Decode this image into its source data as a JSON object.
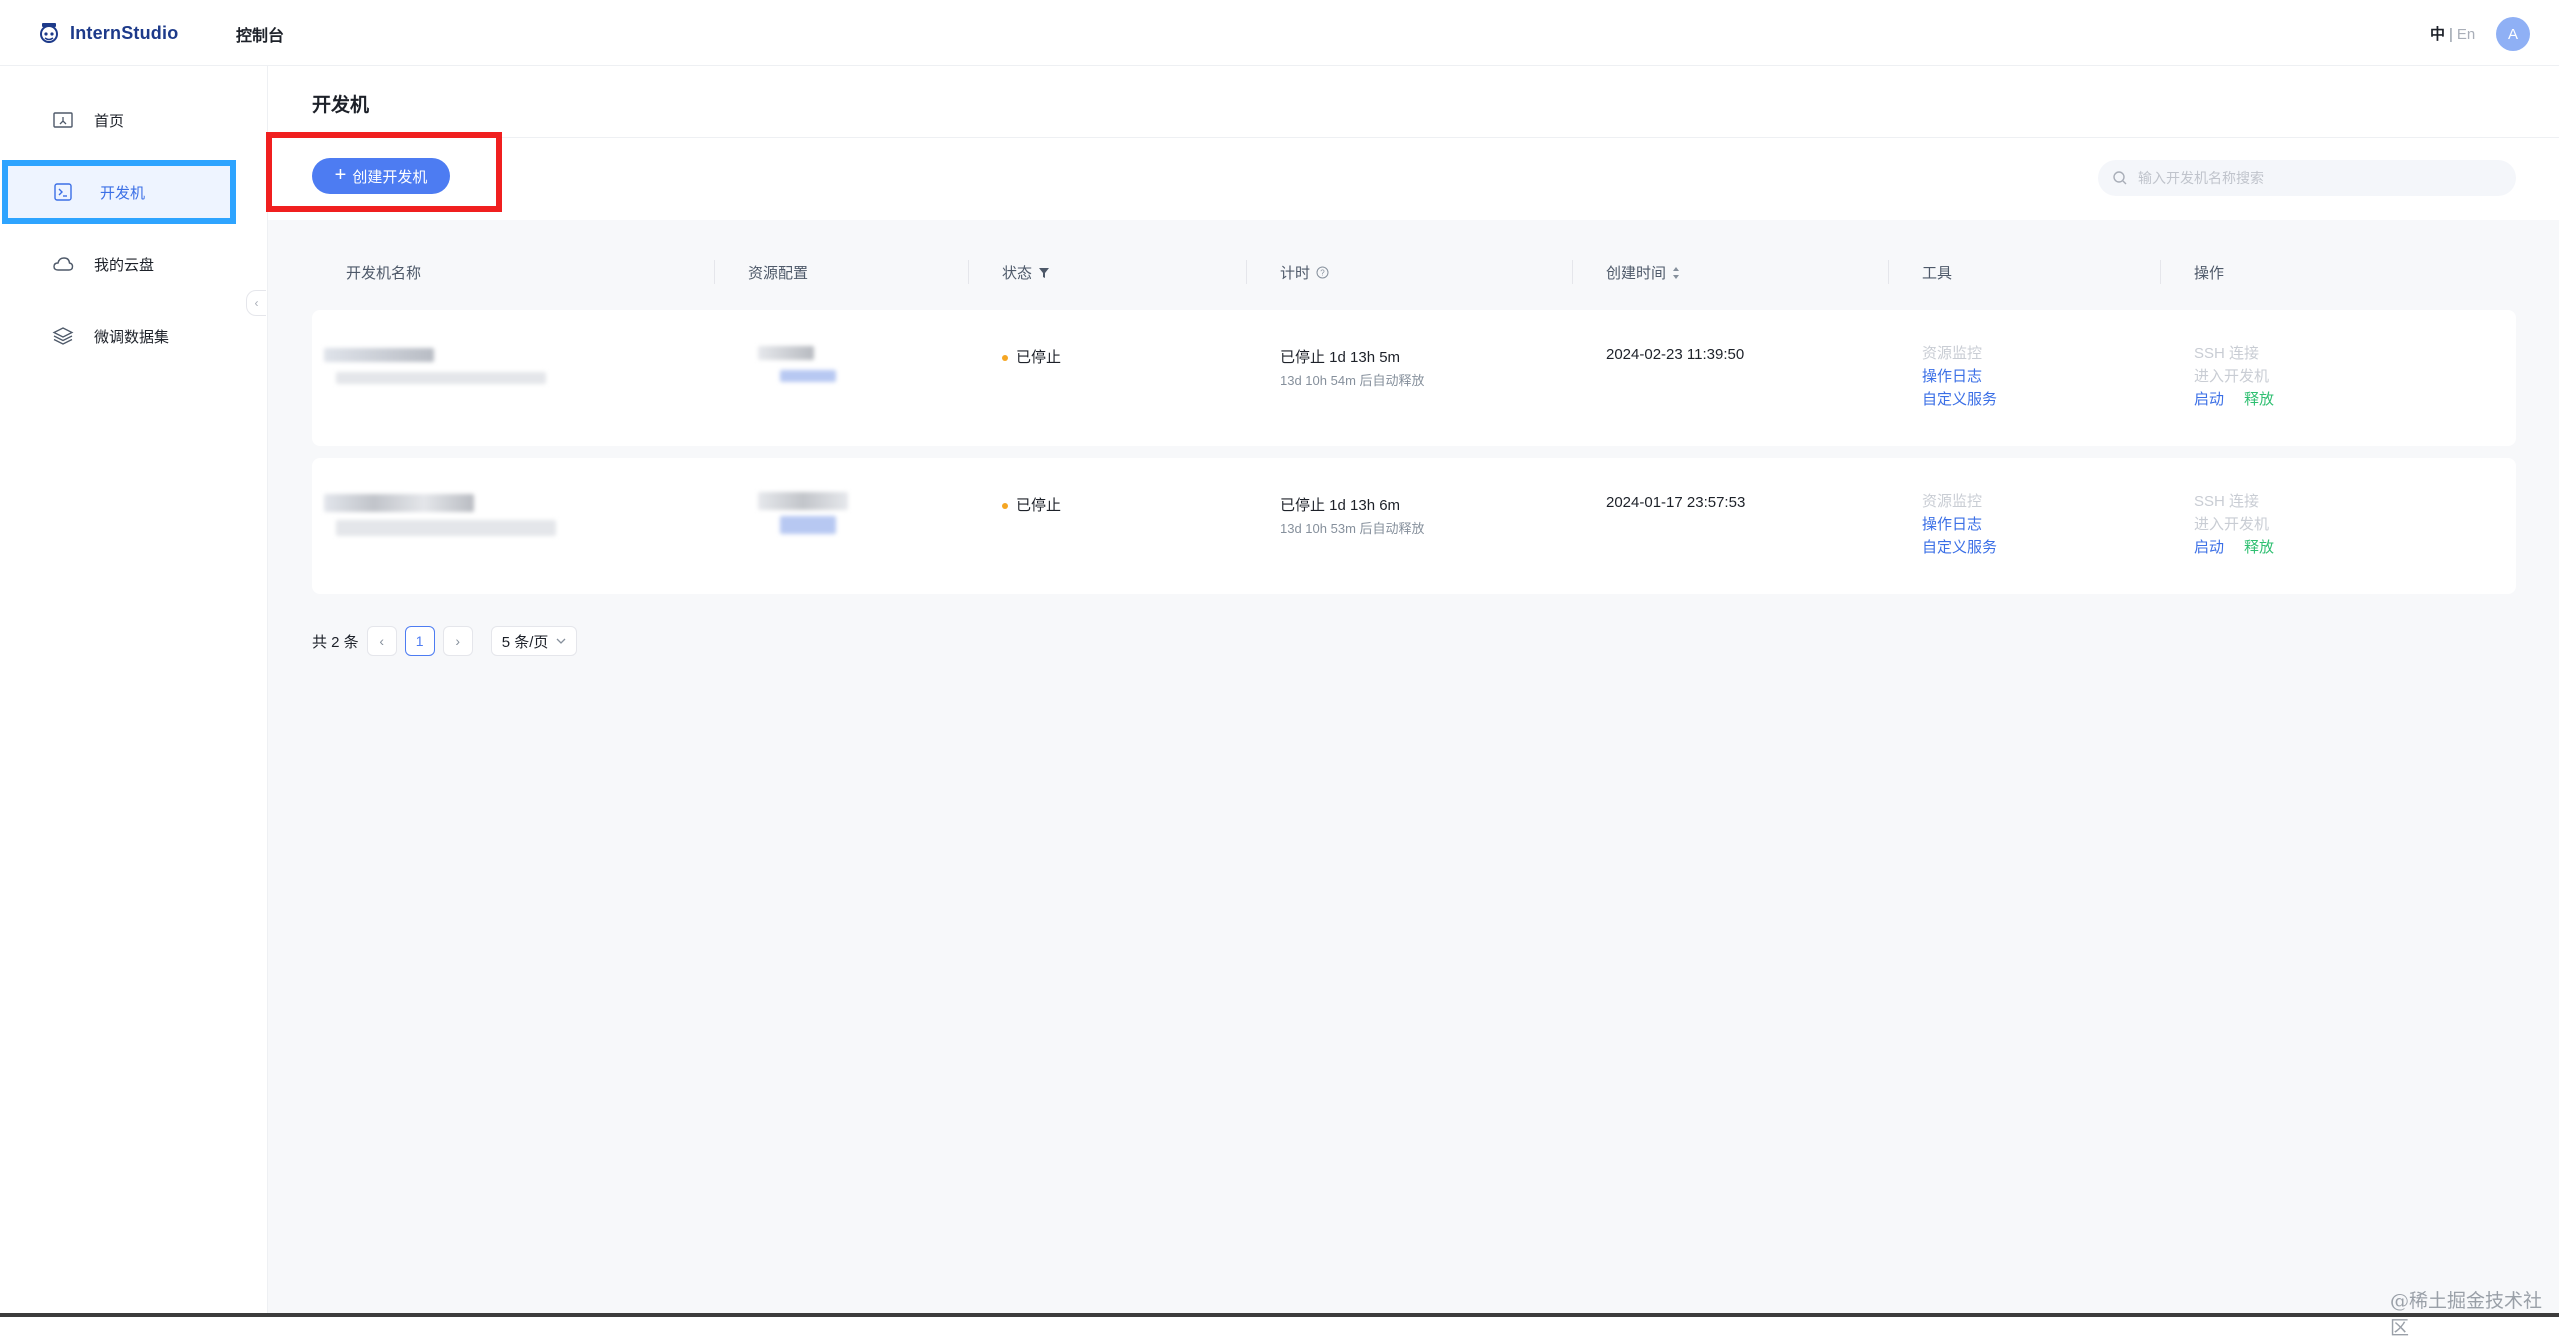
{
  "app": {
    "logo_text": "InternStudio",
    "console_label": "控制台"
  },
  "header": {
    "lang_zh": "中",
    "lang_sep": "|",
    "lang_en": "En",
    "avatar_letter": "A"
  },
  "sidebar": {
    "items": [
      {
        "label": "首页",
        "icon": "home-icon",
        "active": false
      },
      {
        "label": "开发机",
        "icon": "terminal-icon",
        "active": true
      },
      {
        "label": "我的云盘",
        "icon": "cloud-icon",
        "active": false
      },
      {
        "label": "微调数据集",
        "icon": "layers-icon",
        "active": false
      }
    ],
    "collapse_icon": "‹"
  },
  "page": {
    "title": "开发机",
    "create_button": "创建开发机",
    "search_placeholder": "输入开发机名称搜索"
  },
  "table": {
    "columns": {
      "name": "开发机名称",
      "resource": "资源配置",
      "status": "状态",
      "timer": "计时",
      "created": "创建时间",
      "tools": "工具",
      "actions": "操作"
    },
    "rows": [
      {
        "status": "已停止",
        "timer_main": "已停止  1d 13h 5m",
        "timer_sub": "13d 10h 54m 后自动释放",
        "created": "2024-02-23 11:39:50",
        "tool_monitor": "资源监控",
        "tool_log": "操作日志",
        "tool_custom": "自定义服务",
        "action_ssh": "SSH 连接",
        "action_enter": "进入开发机",
        "action_start": "启动",
        "action_release": "释放"
      },
      {
        "status": "已停止",
        "timer_main": "已停止  1d 13h 6m",
        "timer_sub": "13d 10h 53m 后自动释放",
        "created": "2024-01-17 23:57:53",
        "tool_monitor": "资源监控",
        "tool_log": "操作日志",
        "tool_custom": "自定义服务",
        "action_ssh": "SSH 连接",
        "action_enter": "进入开发机",
        "action_start": "启动",
        "action_release": "释放"
      }
    ]
  },
  "pagination": {
    "total": "共 2 条",
    "prev": "‹",
    "current": "1",
    "next": "›",
    "page_size": "5 条/页"
  },
  "watermark": "@稀土掘金技术社区",
  "colors": {
    "primary": "#4d7cf2",
    "active_highlight": "#2ea4ff",
    "create_highlight": "#f01f1f",
    "status_stopped": "#f5a623",
    "release_green": "#2fbf71"
  }
}
